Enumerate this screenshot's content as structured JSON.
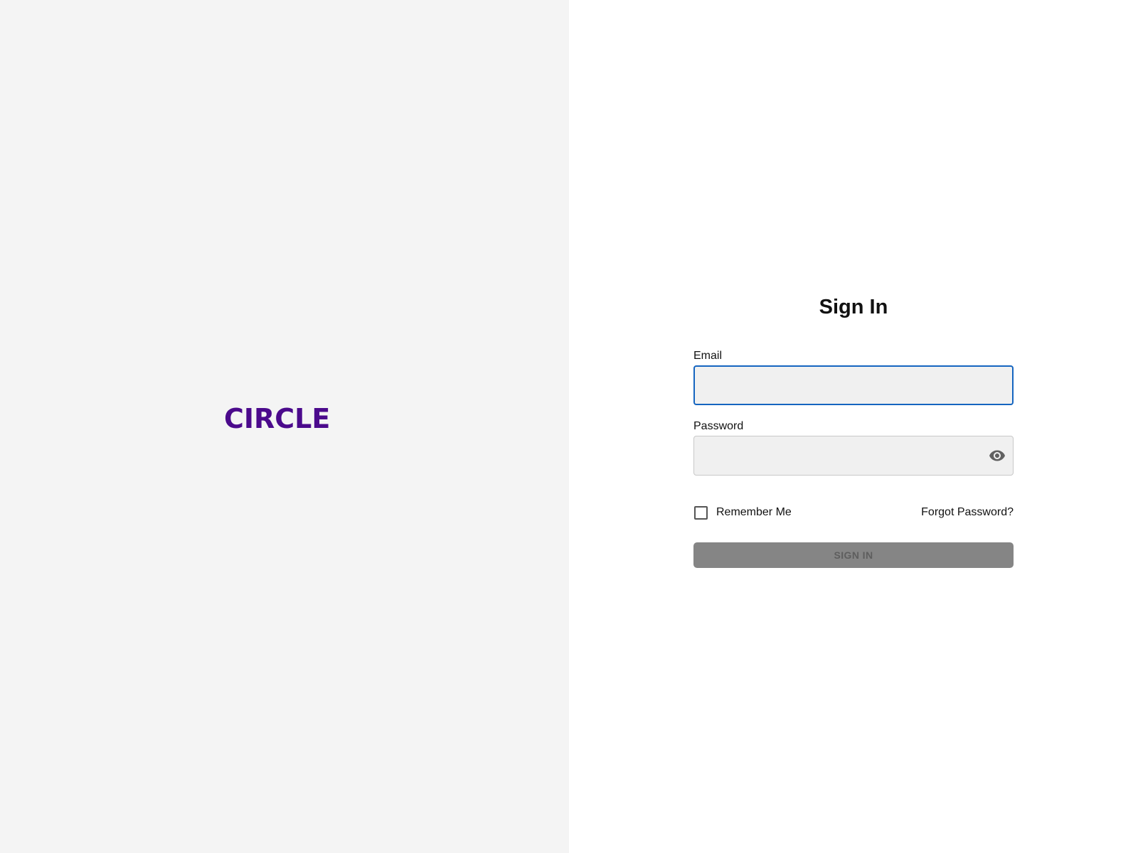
{
  "brand": {
    "logo_text": "CIRCLE",
    "logo_color": "#4b0a8c"
  },
  "form": {
    "title": "Sign In",
    "email": {
      "label": "Email",
      "value": "",
      "focused": true
    },
    "password": {
      "label": "Password",
      "value": "",
      "toggle_icon": "eye-icon"
    },
    "remember_me": {
      "label": "Remember Me",
      "checked": false
    },
    "forgot_password_label": "Forgot Password?",
    "submit": {
      "label": "SIGN IN",
      "disabled": true
    }
  },
  "colors": {
    "left_panel_bg": "#f4f4f4",
    "focus_border": "#1565c0",
    "disabled_button_bg": "#858585"
  }
}
